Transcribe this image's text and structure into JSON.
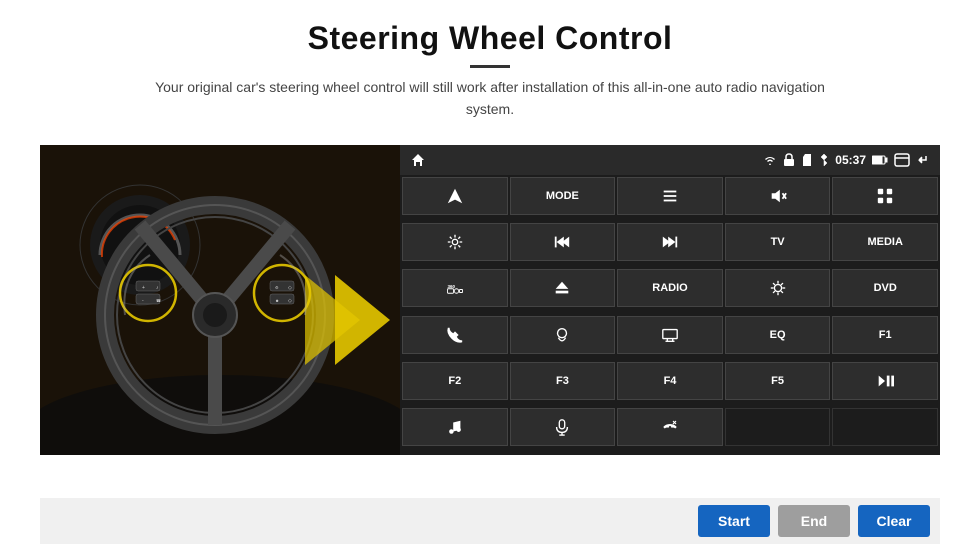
{
  "header": {
    "title": "Steering Wheel Control",
    "subtitle": "Your original car's steering wheel control will still work after installation of this all-in-one auto radio navigation system."
  },
  "statusBar": {
    "time": "05:37",
    "leftIcons": [
      "home-icon"
    ],
    "rightIcons": [
      "wifi-icon",
      "lock-icon",
      "sd-icon",
      "bluetooth-icon",
      "battery-icon",
      "window-icon",
      "back-icon"
    ]
  },
  "radioButtons": [
    {
      "id": "r1",
      "type": "icon",
      "icon": "navigate-icon"
    },
    {
      "id": "r2",
      "type": "text",
      "label": "MODE"
    },
    {
      "id": "r3",
      "type": "icon",
      "icon": "list-icon"
    },
    {
      "id": "r4",
      "type": "icon",
      "icon": "mute-icon"
    },
    {
      "id": "r5",
      "type": "icon",
      "icon": "apps-icon"
    },
    {
      "id": "r6",
      "type": "icon",
      "icon": "settings-icon"
    },
    {
      "id": "r7",
      "type": "icon",
      "icon": "prev-icon"
    },
    {
      "id": "r8",
      "type": "icon",
      "icon": "next-icon"
    },
    {
      "id": "r9",
      "type": "text",
      "label": "TV"
    },
    {
      "id": "r10",
      "type": "text",
      "label": "MEDIA"
    },
    {
      "id": "r11",
      "type": "icon",
      "icon": "360cam-icon"
    },
    {
      "id": "r12",
      "type": "icon",
      "icon": "eject-icon"
    },
    {
      "id": "r13",
      "type": "text",
      "label": "RADIO"
    },
    {
      "id": "r14",
      "type": "icon",
      "icon": "brightness-icon"
    },
    {
      "id": "r15",
      "type": "text",
      "label": "DVD"
    },
    {
      "id": "r16",
      "type": "icon",
      "icon": "phone-icon"
    },
    {
      "id": "r17",
      "type": "icon",
      "icon": "nav2-icon"
    },
    {
      "id": "r18",
      "type": "icon",
      "icon": "screen-icon"
    },
    {
      "id": "r19",
      "type": "text",
      "label": "EQ"
    },
    {
      "id": "r20",
      "type": "text",
      "label": "F1"
    },
    {
      "id": "r21",
      "type": "text",
      "label": "F2"
    },
    {
      "id": "r22",
      "type": "text",
      "label": "F3"
    },
    {
      "id": "r23",
      "type": "text",
      "label": "F4"
    },
    {
      "id": "r24",
      "type": "text",
      "label": "F5"
    },
    {
      "id": "r25",
      "type": "icon",
      "icon": "playpause-icon"
    },
    {
      "id": "r26",
      "type": "icon",
      "icon": "music-icon"
    },
    {
      "id": "r27",
      "type": "icon",
      "icon": "mic-icon"
    },
    {
      "id": "r28",
      "type": "icon",
      "icon": "callend-icon"
    },
    {
      "id": "r29",
      "type": "empty",
      "label": ""
    },
    {
      "id": "r30",
      "type": "empty",
      "label": ""
    }
  ],
  "bottomBar": {
    "startLabel": "Start",
    "endLabel": "End",
    "clearLabel": "Clear"
  }
}
